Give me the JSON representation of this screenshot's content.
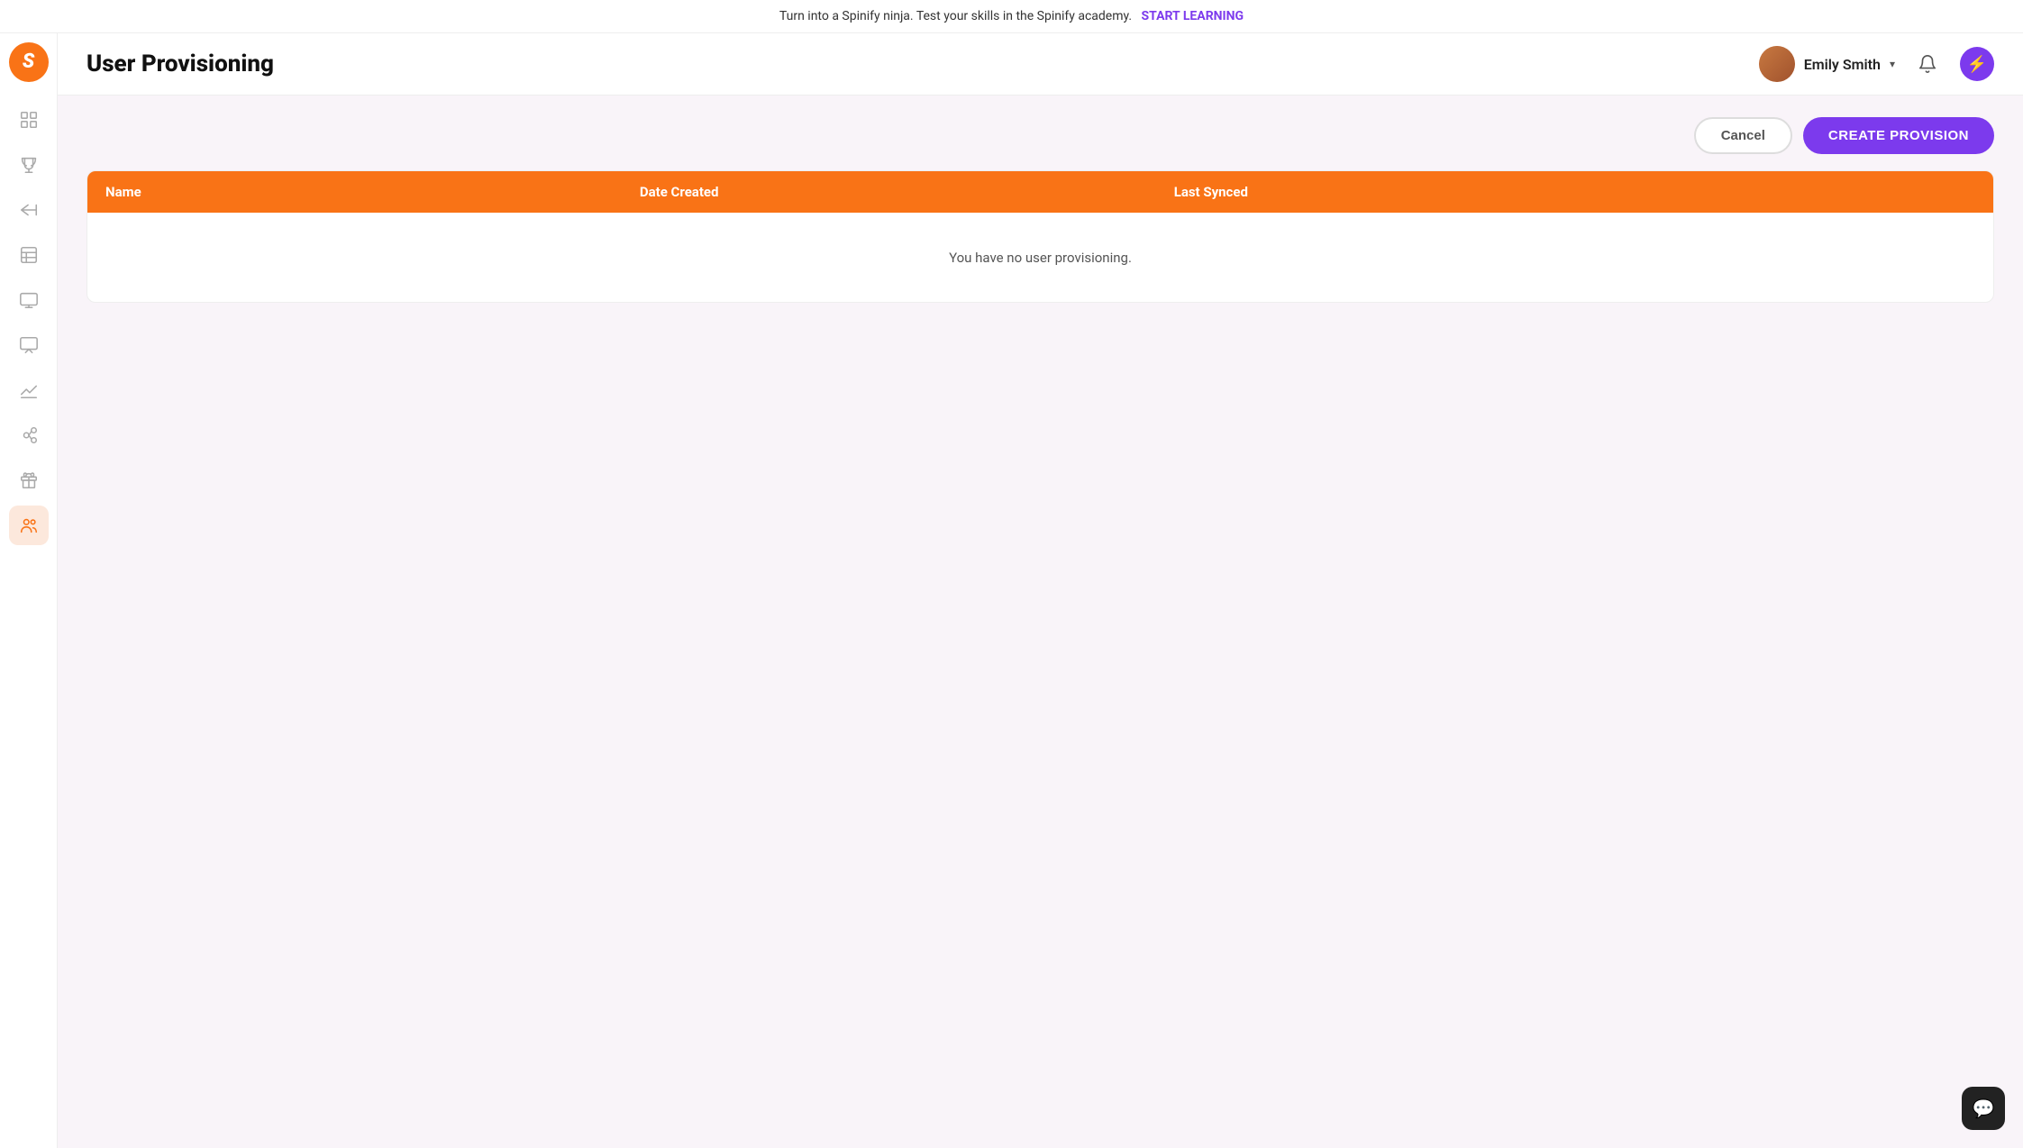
{
  "banner": {
    "text": "Turn into a Spinify ninja. Test your skills in the Spinify academy.",
    "cta": "START LEARNING"
  },
  "header": {
    "title": "User Provisioning",
    "user_name": "Emily Smith",
    "chevron": "▾"
  },
  "toolbar": {
    "cancel_label": "Cancel",
    "create_label": "CREATE PROVISION"
  },
  "table": {
    "columns": [
      "Name",
      "Date Created",
      "Last Synced"
    ],
    "empty_message": "You have no user provisioning."
  },
  "sidebar": {
    "logo_letter": "S",
    "items": [
      {
        "name": "dashboard",
        "label": "Dashboard"
      },
      {
        "name": "trophy",
        "label": "Trophy"
      },
      {
        "name": "megaphone",
        "label": "Announcements"
      },
      {
        "name": "report",
        "label": "Reports"
      },
      {
        "name": "screen",
        "label": "Screen"
      },
      {
        "name": "monitor",
        "label": "Monitor"
      },
      {
        "name": "chart",
        "label": "Chart"
      },
      {
        "name": "integration",
        "label": "Integrations"
      },
      {
        "name": "gift",
        "label": "Gifts"
      },
      {
        "name": "users",
        "label": "Users"
      }
    ]
  },
  "icons": {
    "bolt": "⚡",
    "chat": "💬"
  }
}
